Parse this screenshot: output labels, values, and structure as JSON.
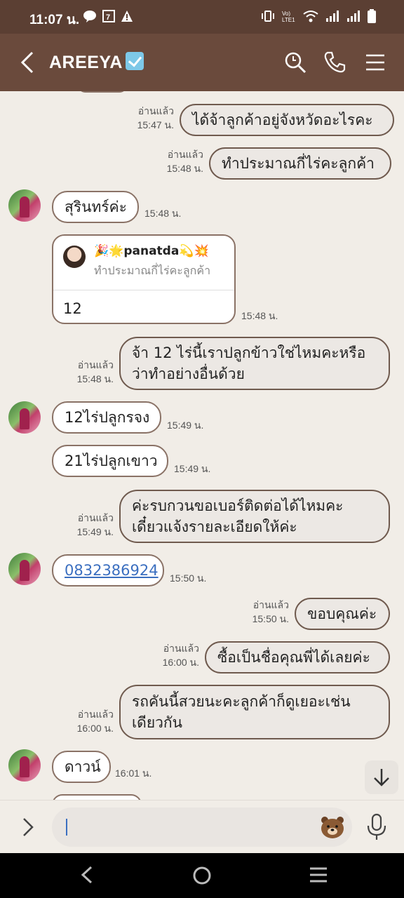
{
  "status_bar": {
    "time": "11:07 น."
  },
  "header": {
    "title": "AREEYA"
  },
  "messages": [
    {
      "side": "out",
      "text": "ได้จ้าลูกค้าอยู่จังหวัดอะไรคะ",
      "read": "อ่านแล้ว",
      "time": "15:47 น."
    },
    {
      "side": "out",
      "text": "ทำประมาณกี่ไร่คะลูกค้า",
      "read": "อ่านแล้ว",
      "time": "15:48 น."
    },
    {
      "side": "in",
      "text": "สุรินทร์ค่ะ",
      "time": "15:48 น."
    },
    {
      "side": "in",
      "reply_name": "🎉🌟panatda💫💥",
      "reply_quote": "ทำประมาณกี่ไร่คะลูกค้า",
      "text": "12",
      "time": "15:48 น."
    },
    {
      "side": "out",
      "text": "จ้า 12 ไร่นี้เราปลูกข้าวใช่ไหมคะหรือว่าทำอย่างอื่นด้วย",
      "line1": "จ้า 12 ไร่นี้เราปลูกข้าวใช่ไหมคะหรือ",
      "line2": "ว่าทำอย่างอื่นด้วย",
      "read": "อ่านแล้ว",
      "time": "15:48 น."
    },
    {
      "side": "in",
      "text": "12ไร่ปลูกรจง",
      "time": "15:49 น."
    },
    {
      "side": "in",
      "text": "21ไร่ปลูกเขาว",
      "time": "15:49 น."
    },
    {
      "side": "out",
      "line1": "ค่ะรบกวนขอเบอร์ติดต่อได้ไหมคะ",
      "line2": "เดี๋ยวแจ้งรายละเอียดให้ค่ะ",
      "read": "อ่านแล้ว",
      "time": "15:49 น."
    },
    {
      "side": "in",
      "text": "0832386924",
      "time": "15:50 น."
    },
    {
      "side": "out",
      "text": "ขอบคุณค่ะ",
      "read": "อ่านแล้ว",
      "time": "15:50 น."
    },
    {
      "side": "out",
      "text": "ซื้อเป็นชื่อคุณพี่ได้เลยค่ะ",
      "read": "อ่านแล้ว",
      "time": "16:00 น."
    },
    {
      "side": "out",
      "line1": "รถคันนี้สวยนะคะลูกค้าก็ดูเยอะเช่น",
      "line2": "เดียวกัน",
      "read": "อ่านแล้ว",
      "time": "16:00 น."
    },
    {
      "side": "in",
      "text": "ดาวน์",
      "time": "16:01 น."
    }
  ],
  "input": {
    "placeholder": ""
  },
  "colors": {
    "header": "#6a4a3c",
    "status_bar": "#5b3f33",
    "chat_bg": "#f1ede7",
    "link": "#3b6fc0"
  }
}
